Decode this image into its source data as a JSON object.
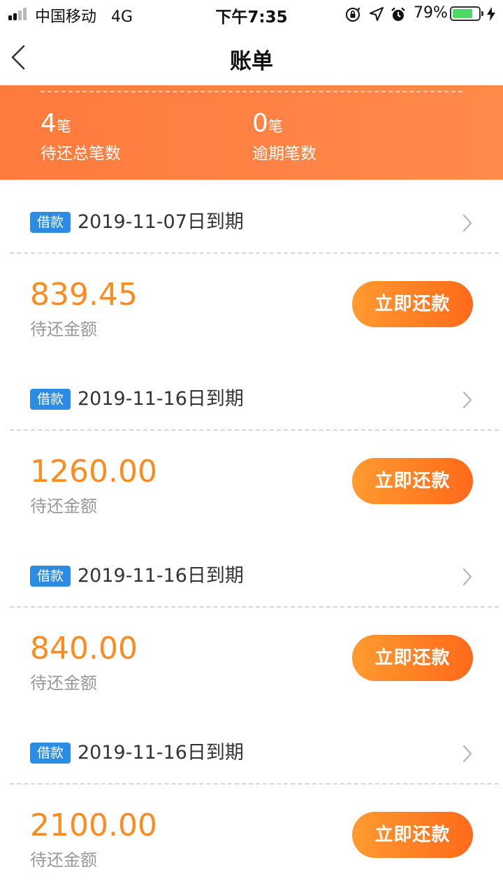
{
  "status_bar": {
    "carrier": "中国移动",
    "network": "4G",
    "time": "下午7:35",
    "battery": "79%",
    "battery_level": 0.79,
    "icons": [
      "signal-icon",
      "orientation-lock-icon",
      "location-arrow-icon",
      "alarm-icon",
      "battery-icon",
      "charging-bolt-icon"
    ]
  },
  "nav": {
    "title": "账单",
    "back_icon": "chevron-left-icon"
  },
  "summary": {
    "total": {
      "value": "4",
      "unit": "笔",
      "label": "待还总笔数"
    },
    "overdue": {
      "value": "0",
      "unit": "笔",
      "label": "逾期笔数"
    }
  },
  "bills": [
    {
      "tag": "借款",
      "due": "2019-11-07日到期",
      "amount": "839.45",
      "amount_label": "待还金额",
      "button": "立即还款"
    },
    {
      "tag": "借款",
      "due": "2019-11-16日到期",
      "amount": "1260.00",
      "amount_label": "待还金额",
      "button": "立即还款"
    },
    {
      "tag": "借款",
      "due": "2019-11-16日到期",
      "amount": "840.00",
      "amount_label": "待还金额",
      "button": "立即还款"
    },
    {
      "tag": "借款",
      "due": "2019-11-16日到期",
      "amount": "2100.00",
      "amount_label": "待还金额",
      "button": "立即还款"
    }
  ],
  "colors": {
    "accent": "#ff7a3d",
    "amount": "#ff8b1f",
    "tag": "#2b8ce6",
    "button_start": "#ff9a30",
    "button_end": "#ff6a1a"
  }
}
